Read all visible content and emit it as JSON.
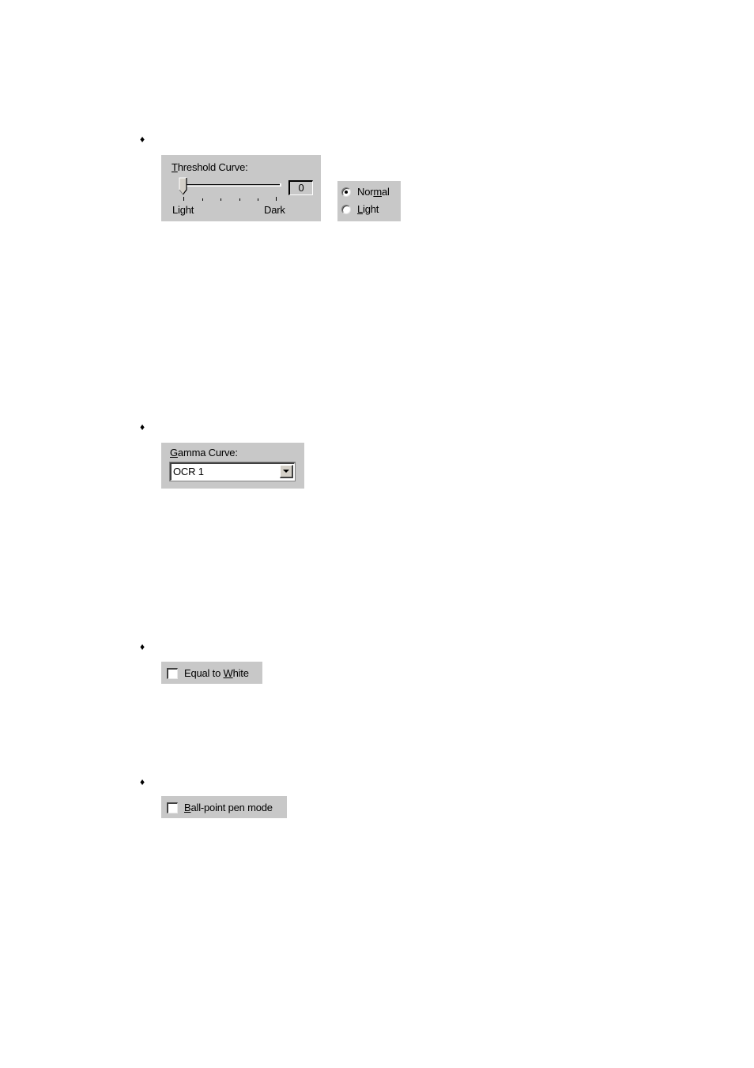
{
  "bullets": [
    "♦",
    "♦",
    "♦",
    "♦"
  ],
  "threshold": {
    "title_underlined": "T",
    "title_rest": "hreshold Curve:",
    "value": "0",
    "slider_min_label": "Light",
    "slider_max_label": "Dark",
    "slider_position": 0,
    "tick_count": 6
  },
  "mode": {
    "options": [
      {
        "pre": "Nor",
        "underlined": "m",
        "post": "al",
        "selected": true
      },
      {
        "pre": "",
        "underlined": "L",
        "post": "ight",
        "selected": false
      }
    ]
  },
  "gamma": {
    "title_underlined": "G",
    "title_rest": "amma Curve:",
    "selected_value": "OCR 1"
  },
  "equal_to_white": {
    "pre": "Equal to ",
    "underlined": "W",
    "post": "hite",
    "checked": false
  },
  "ballpoint": {
    "pre": "",
    "underlined": "B",
    "post": "all-point pen mode",
    "checked": false
  },
  "colors": {
    "panel_bg": "#c8c8c8",
    "page_bg": "#ffffff"
  }
}
